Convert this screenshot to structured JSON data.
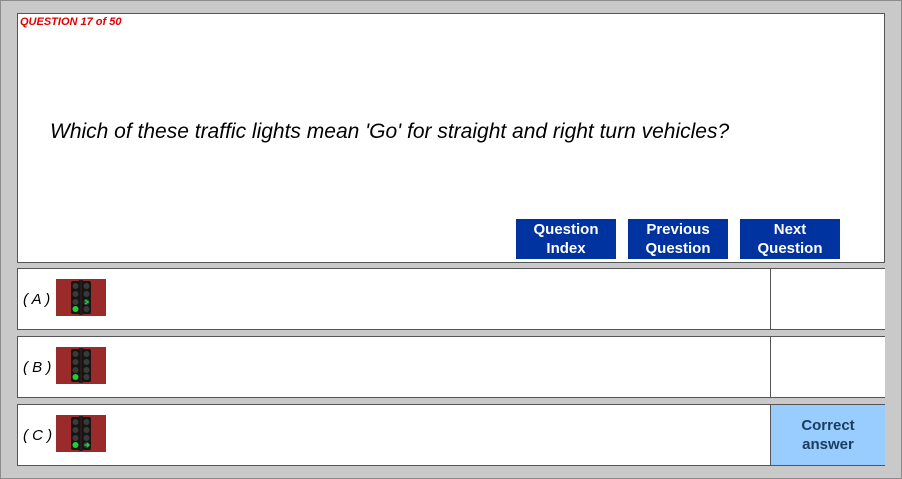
{
  "question": {
    "counter": "QUESTION 17 of 50",
    "text": "Which of these traffic lights mean 'Go' for straight and right turn vehicles?"
  },
  "nav": {
    "index_line1": "Question",
    "index_line2": "Index",
    "prev_line1": "Previous",
    "prev_line2": "Question",
    "next_line1": "Next",
    "next_line2": "Question",
    "button_color": "#0033a0"
  },
  "options": [
    {
      "label": "( A )",
      "image_icon": "traffic-light-green-straight-and-right-arrow-icon",
      "status_line1": "",
      "status_line2": ""
    },
    {
      "label": "( B )",
      "image_icon": "traffic-light-green-straight-icon",
      "status_line1": "",
      "status_line2": ""
    },
    {
      "label": "( C )",
      "image_icon": "traffic-light-green-straight-and-green-right-arrow-icon",
      "status_line1": "Correct",
      "status_line2": "answer",
      "status_color": "#99ccff"
    }
  ],
  "colors": {
    "counter_red": "#e00000",
    "image_background": "#9b2a2a",
    "green_light": "#22cc33"
  }
}
